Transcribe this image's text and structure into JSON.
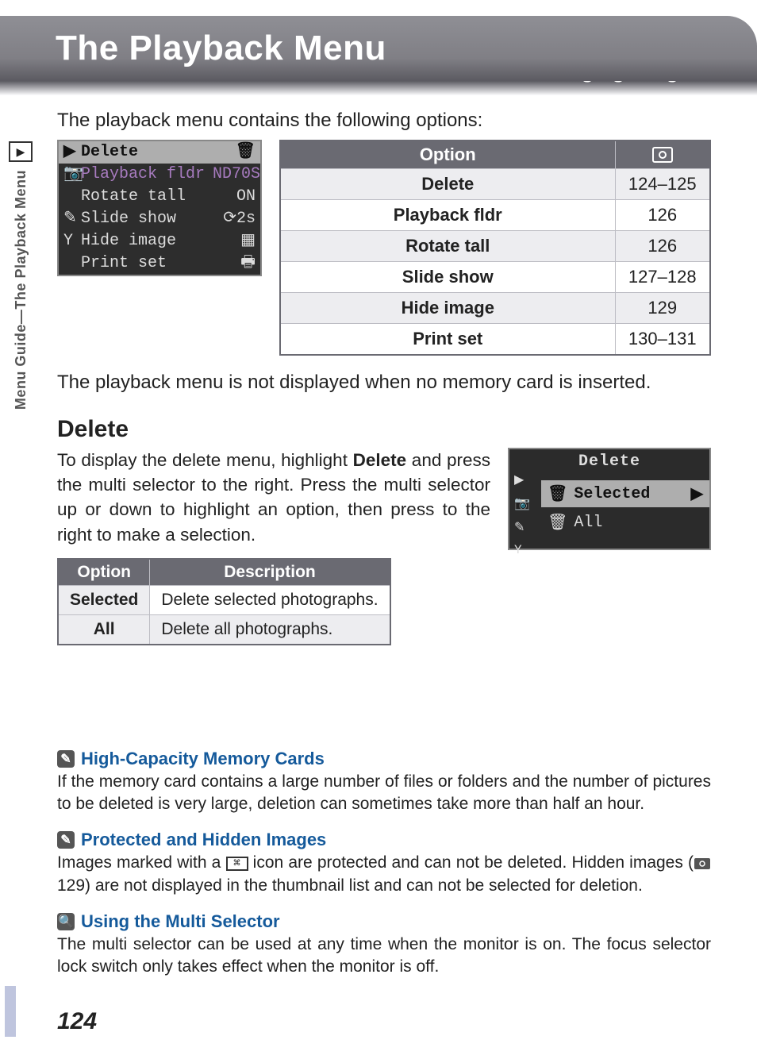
{
  "header": {
    "title": "The Playback Menu",
    "subtitle": "Managing Images"
  },
  "side_tab": {
    "text": "Menu Guide—The Playback Menu",
    "icon_glyph": "▶"
  },
  "intro": "The playback menu contains the following options:",
  "lcd_menu": {
    "rows": [
      {
        "icon": "▶",
        "label": "Delete",
        "value": "🗑",
        "highlight": true
      },
      {
        "icon": "📷",
        "label": "Playback fldr",
        "value": "ND70S",
        "purple": true
      },
      {
        "icon": "",
        "label": "Rotate tall",
        "value": "ON"
      },
      {
        "icon": "✎",
        "label": "Slide show",
        "value": "⟳2s"
      },
      {
        "icon": "Y",
        "label": "Hide image",
        "value": "▦"
      },
      {
        "icon": "",
        "label": "Print set",
        "value": "🖶"
      }
    ]
  },
  "options_table": {
    "head": {
      "option": "Option",
      "page_icon_label": "page-ref-icon"
    },
    "rows": [
      {
        "option": "Delete",
        "pages": "124–125"
      },
      {
        "option": "Playback fldr",
        "pages": "126"
      },
      {
        "option": "Rotate tall",
        "pages": "126"
      },
      {
        "option": "Slide show",
        "pages": "127–128"
      },
      {
        "option": "Hide image",
        "pages": "129"
      },
      {
        "option": "Print set",
        "pages": "130–131"
      }
    ]
  },
  "menu_note": "The playback menu is not displayed when no memory card is inserted.",
  "delete_section": {
    "heading": "Delete",
    "body_pre": "To display the delete menu, highlight ",
    "body_bold": "Delete",
    "body_post": " and press the multi selector to the right.  Press the multi selector up or down to highlight an option, then press to the right to make a selection.",
    "lcd": {
      "title": "Delete",
      "rows": [
        {
          "icon": "🗑",
          "label": "Selected",
          "selected": true,
          "arrow": "▶"
        },
        {
          "icon": "🗑",
          "label": "All",
          "selected": false,
          "arrow": ""
        }
      ]
    },
    "table": {
      "head": {
        "option": "Option",
        "description": "Description"
      },
      "rows": [
        {
          "option": "Selected",
          "description": "Delete selected photographs."
        },
        {
          "option": "All",
          "description": "Delete all photographs."
        }
      ]
    }
  },
  "tips": {
    "t1": {
      "title": "High-Capacity Memory Cards",
      "body": "If the memory card contains a large number of files or folders and the number of pictures to be deleted is very large, deletion can sometimes take more than half an hour."
    },
    "t2": {
      "title": "Protected and Hidden Images",
      "body_pre": "Images marked with a ",
      "body_mid": " icon are protected and can not be deleted.  Hidden images (",
      "body_ref": " 129) are not displayed in the thumbnail list and can not be selected for deletion."
    },
    "t3": {
      "title": "Using the Multi Selector",
      "body": "The multi selector can be used at any time when the monitor is on.  The focus selector lock switch only takes effect when the monitor is off."
    }
  },
  "page_number": "124"
}
